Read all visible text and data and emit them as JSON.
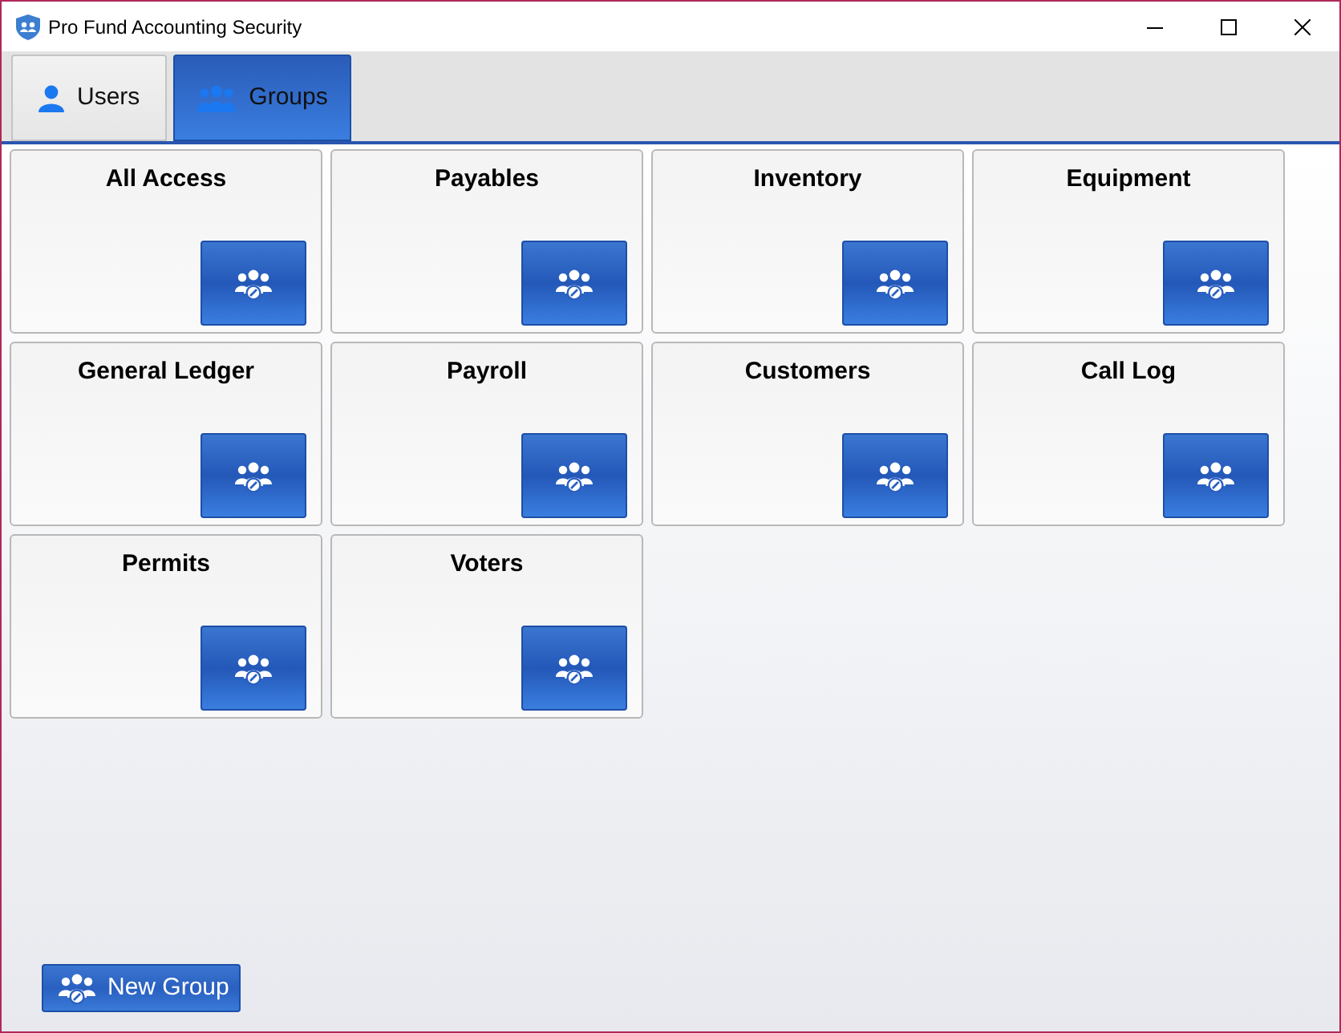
{
  "window": {
    "title": "Pro Fund Accounting Security"
  },
  "tabs": [
    {
      "label": "Users",
      "kind": "user",
      "selected": false
    },
    {
      "label": "Groups",
      "kind": "group",
      "selected": true
    }
  ],
  "groups": [
    {
      "name": "All Access"
    },
    {
      "name": "Payables"
    },
    {
      "name": "Inventory"
    },
    {
      "name": "Equipment"
    },
    {
      "name": "General Ledger"
    },
    {
      "name": "Payroll"
    },
    {
      "name": "Customers"
    },
    {
      "name": "Call Log"
    },
    {
      "name": "Permits"
    },
    {
      "name": "Voters"
    }
  ],
  "new_group_button": {
    "label": "New Group"
  }
}
